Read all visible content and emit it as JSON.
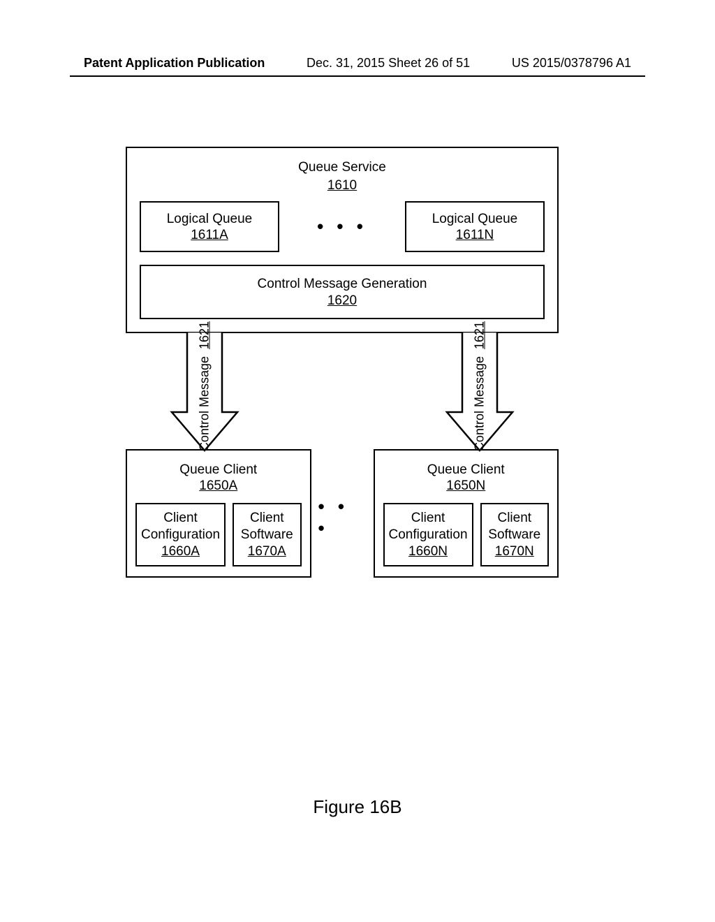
{
  "header": {
    "left": "Patent Application Publication",
    "mid": "Dec. 31, 2015  Sheet 26 of 51",
    "right": "US 2015/0378796 A1"
  },
  "queue_service": {
    "title": "Queue Service",
    "id": "1610",
    "logical_queues": [
      {
        "label": "Logical Queue",
        "id": "1611A"
      },
      {
        "label": "Logical Queue",
        "id": "1611N"
      }
    ],
    "ellipsis": "• • •",
    "control_msg_gen": {
      "label": "Control Message Generation",
      "id": "1620"
    }
  },
  "control_message": {
    "label": "Control Message",
    "id": "1621"
  },
  "clients_ellipsis": "• • •",
  "queue_clients": [
    {
      "title": "Queue Client",
      "id": "1650A",
      "config": {
        "label": "Client Configuration",
        "id": "1660A"
      },
      "software": {
        "label": "Client Software",
        "id": "1670A"
      }
    },
    {
      "title": "Queue Client",
      "id": "1650N",
      "config": {
        "label": "Client Configuration",
        "id": "1660N"
      },
      "software": {
        "label": "Client Software",
        "id": "1670N"
      }
    }
  ],
  "figure_caption": "Figure 16B"
}
